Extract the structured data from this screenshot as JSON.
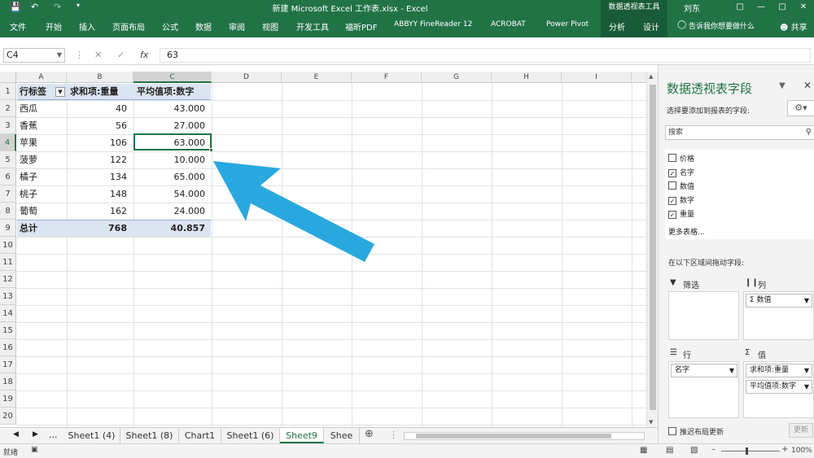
{
  "titlebar": {
    "title": "新建 Microsoft Excel 工作表.xlsx  -  Excel",
    "context_group": "数据透视表工具",
    "user": "刘东",
    "save_icon": "save-icon",
    "undo_icon": "undo-icon",
    "redo_icon": "redo-icon"
  },
  "ribbon": {
    "tabs": [
      "文件",
      "开始",
      "插入",
      "页面布局",
      "公式",
      "数据",
      "审阅",
      "视图",
      "开发工具",
      "福昕PDF",
      "ABBYY FineReader 12",
      "ACROBAT",
      "Power Pivot",
      "分析",
      "设计"
    ],
    "tell_me": "告诉我你想要做什么",
    "share": "共享"
  },
  "formula_bar": {
    "name_box": "C4",
    "cancel": "✕",
    "confirm": "✓",
    "fx": "fx",
    "value": "63"
  },
  "sheet": {
    "columns": [
      "A",
      "B",
      "C",
      "D",
      "E",
      "F",
      "G",
      "H",
      "I"
    ],
    "rows": [
      "1",
      "2",
      "3",
      "4",
      "5",
      "6",
      "7",
      "8",
      "9",
      "10",
      "11",
      "12",
      "13",
      "14",
      "15",
      "16",
      "17",
      "18",
      "19",
      "20"
    ],
    "header": {
      "row_label": "行标签",
      "sum_weight": "求和项:重量",
      "avg_number": "平均值项:数字"
    },
    "data": [
      {
        "name": "西瓜",
        "weight": "40",
        "avg": "43.000"
      },
      {
        "name": "香蕉",
        "weight": "56",
        "avg": "27.000"
      },
      {
        "name": "苹果",
        "weight": "106",
        "avg": "63.000"
      },
      {
        "name": "菠萝",
        "weight": "122",
        "avg": "10.000"
      },
      {
        "name": "橘子",
        "weight": "134",
        "avg": "65.000"
      },
      {
        "name": "桃子",
        "weight": "148",
        "avg": "54.000"
      },
      {
        "name": "葡萄",
        "weight": "162",
        "avg": "24.000"
      }
    ],
    "total": {
      "label": "总计",
      "weight": "768",
      "avg": "40.857"
    },
    "arrow_color": "#29a8e0"
  },
  "sheet_tabs": {
    "items": [
      "Sheet1 (4)",
      "Sheet1 (8)",
      "Chart1",
      "Sheet1 (6)",
      "Sheet9",
      "Shee"
    ],
    "active": "Sheet9",
    "ellipsis": "..."
  },
  "status": {
    "ready": "就绪",
    "zoom": "100%"
  },
  "pivot_pane": {
    "title": "数据透视表字段",
    "subtitle": "选择要添加到报表的字段:",
    "search_placeholder": "搜索",
    "fields": [
      {
        "label": "价格",
        "checked": false
      },
      {
        "label": "名字",
        "checked": true
      },
      {
        "label": "数值",
        "checked": false
      },
      {
        "label": "数字",
        "checked": true
      },
      {
        "label": "重量",
        "checked": true
      }
    ],
    "more_tables": "更多表格...",
    "drag_hint": "在以下区域间拖动字段:",
    "filters_label": "筛选",
    "columns_label": "列",
    "rows_label": "行",
    "values_label": "值",
    "columns_item": "Σ 数值",
    "rows_item": "名字",
    "values_items": [
      "求和项:重量",
      "平均值项:数字"
    ],
    "defer_label": "推迟布局更新",
    "update_label": "更新"
  },
  "colors": {
    "excel_green": "#217346",
    "pivot_header": "#dbe5f1"
  }
}
